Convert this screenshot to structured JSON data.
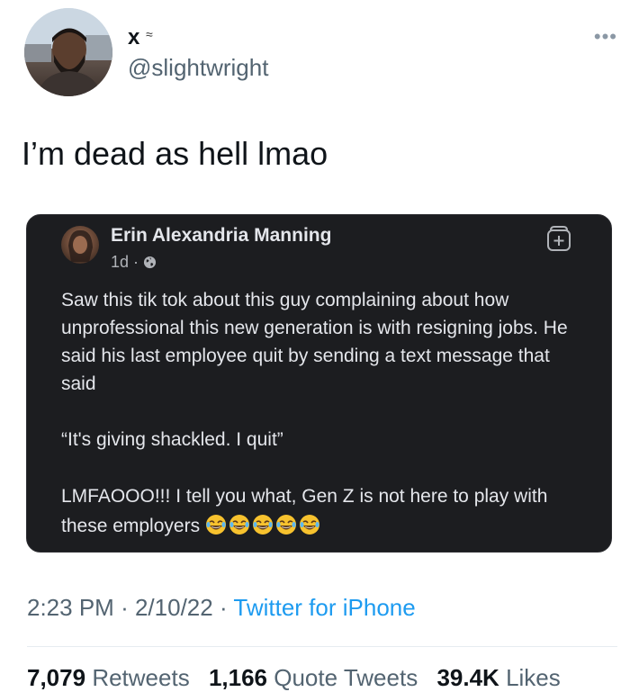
{
  "author": {
    "display_name": "x",
    "name_emoji": "≈",
    "handle": "@slightwright",
    "avatar_icon": "profile-photo"
  },
  "more_icon": "more-icon",
  "tweet_text": "I’m dead as hell lmao",
  "quoted_post": {
    "author": "Erin Alexandria Manning",
    "age": "1d",
    "separator": "·",
    "visibility_icon": "globe-icon",
    "save_icon": "save-icon",
    "paragraphs": [
      "Saw this tik tok about this guy complaining about how unprofessional this new generation is with resigning jobs. He said his last employee quit by sending a text message that said",
      "“It's giving shackled. I quit”",
      "LMFAOOO!!! I tell you what, Gen Z is not here to play with these employers"
    ],
    "emoji_count": 5,
    "emoji_icon": "laughing-emoji"
  },
  "meta": {
    "time": "2:23 PM",
    "date": "2/10/22",
    "sep": "·",
    "source": "Twitter for iPhone"
  },
  "stats": {
    "retweets_num": "7,079",
    "retweets_label": "Retweets",
    "quotes_num": "1,166",
    "quotes_label": "Quote Tweets",
    "likes_num": "39.4K",
    "likes_label": "Likes"
  },
  "colors": {
    "link_blue": "#1d9bf0",
    "card_bg": "#1c1d20",
    "secondary_text": "#536471"
  }
}
